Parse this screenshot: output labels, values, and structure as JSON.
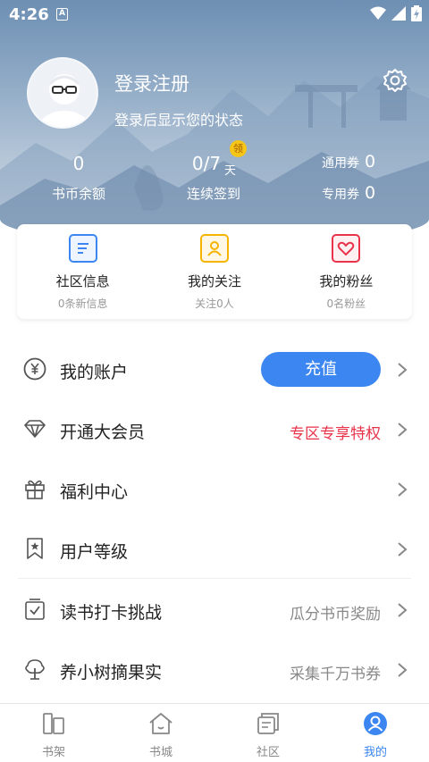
{
  "status_bar": {
    "time": "4:26",
    "notif_letter": "A"
  },
  "profile": {
    "title": "登录注册",
    "subtitle": "登录后显示您的状态"
  },
  "stats": {
    "balance": {
      "value": "0",
      "label": "书币余额"
    },
    "checkin": {
      "value": "0/7",
      "unit": "天",
      "badge": "领",
      "label": "连续签到"
    },
    "coupons": [
      {
        "label": "通用券",
        "value": "0"
      },
      {
        "label": "专用券",
        "value": "0"
      }
    ]
  },
  "card": {
    "items": [
      {
        "title": "社区信息",
        "sub": "0条新信息",
        "icon": "message-list-icon",
        "color": "#3b86f0"
      },
      {
        "title": "我的关注",
        "sub": "关注0人",
        "icon": "person-icon",
        "color": "#f5b400"
      },
      {
        "title": "我的粉丝",
        "sub": "0名粉丝",
        "icon": "heart-icon",
        "color": "#e8334a"
      }
    ]
  },
  "menu": {
    "account": {
      "label": "我的账户",
      "button": "充值"
    },
    "vip": {
      "label": "开通大会员",
      "right": "专区专享特权"
    },
    "welfare": {
      "label": "福利中心"
    },
    "level": {
      "label": "用户等级"
    },
    "challenge": {
      "label": "读书打卡挑战",
      "right": "瓜分书币奖励"
    },
    "tree": {
      "label": "养小树摘果实",
      "right": "采集千万书券"
    }
  },
  "nav": {
    "items": [
      {
        "label": "书架",
        "icon": "bookshelf-icon"
      },
      {
        "label": "书城",
        "icon": "home-icon"
      },
      {
        "label": "社区",
        "icon": "community-icon"
      },
      {
        "label": "我的",
        "icon": "profile-icon",
        "active": true
      }
    ]
  },
  "colors": {
    "accent": "#3b86f0",
    "vip_red": "#e8334a",
    "badge_yellow": "#f5c518"
  }
}
